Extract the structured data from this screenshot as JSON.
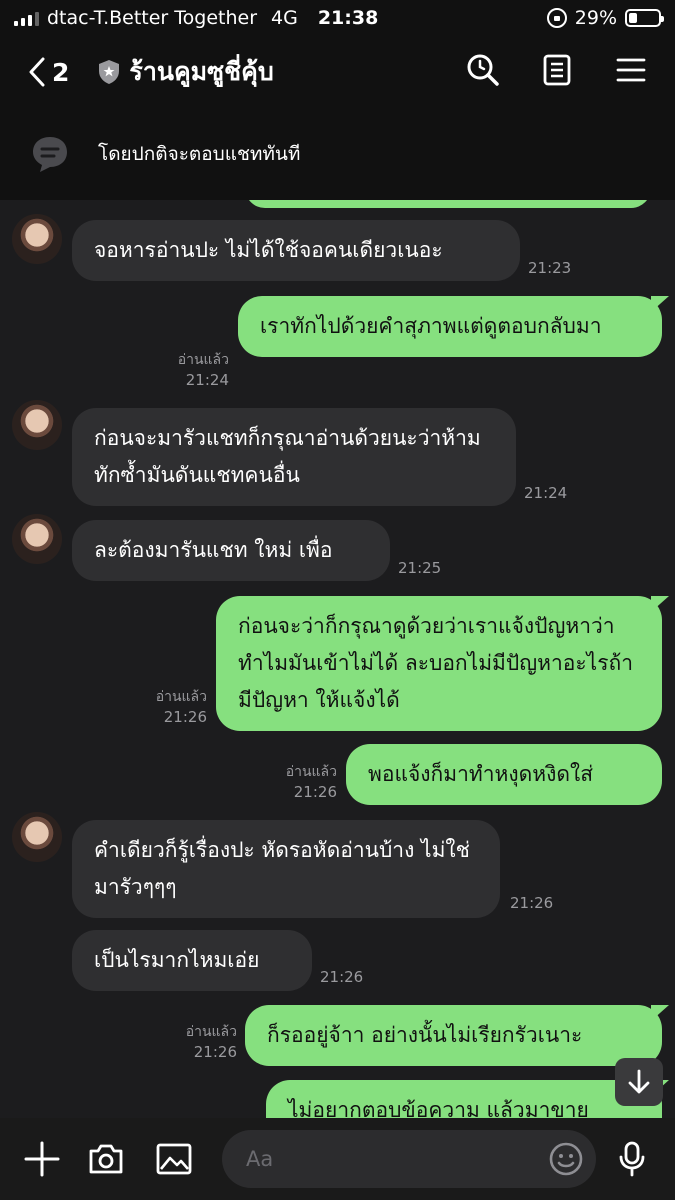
{
  "status": {
    "carrier": "dtac-T.Better Together",
    "network": "4G",
    "time": "21:38",
    "battery": "29%",
    "battery_level": 0.29
  },
  "header": {
    "back_count": "2",
    "title": "ร้านคูมซูชี่คุ้บ",
    "icons": [
      "back-icon",
      "shield-icon",
      "search-icon",
      "notes-icon",
      "menu-icon"
    ]
  },
  "notice": {
    "text": "โดยปกติจะตอบแชททันที",
    "icon": "chat-bubble-icon"
  },
  "messages": [
    {
      "side": "in",
      "text": "จอหารอ่านปะ ไม่ได้ใช้จอคนเดียวเนอะ",
      "time": "21:23"
    },
    {
      "side": "out",
      "text": "เราทักไปด้วยคำสุภาพแต่ดูตอบกลับมา",
      "status": "อ่านแล้ว",
      "time": "21:24"
    },
    {
      "side": "in",
      "text": "ก่อนจะมารัวแชทก็กรุณาอ่านด้วยนะว่าห้ามทักซ้ำมันดันแชทคนอื่น",
      "time": "21:24"
    },
    {
      "side": "in",
      "text": "ละต้องมารันแชท ใหม่ เพื่อ",
      "time": "21:25"
    },
    {
      "side": "out",
      "text": "ก่อนจะว่าก็กรุณาดูด้วยว่าเราแจ้งปัญหาว่าทำไมมันเข้าไม่ได้ ละบอกไม่มีปัญหาอะไรถ้ามีปัญหา ให้แจ้งได้",
      "status": "อ่านแล้ว",
      "time": "21:26"
    },
    {
      "side": "out",
      "text": "พอแจ้งก็มาทำหงุดหงิดใส่",
      "status": "อ่านแล้ว",
      "time": "21:26"
    },
    {
      "side": "in",
      "text": "คำเดียวก็รู้เรื่องปะ หัดรอหัดอ่านบ้าง ไม่ใช่มารัวๆๆๆ",
      "time": "21:26"
    },
    {
      "side": "in",
      "text": "เป็นไรมากไหมเอ่ย",
      "time": "21:26"
    },
    {
      "side": "out",
      "text": "ก็รออยู่จ้าา อย่างนั้นไม่เรียกรัวเนาะ",
      "status": "อ่านแล้ว",
      "time": "21:26"
    },
    {
      "side": "out",
      "text": "ไม่อยากตอบข้อความ แล้วมาขาย",
      "status": "",
      "time": ""
    }
  ],
  "input": {
    "placeholder": "Aa",
    "icons": [
      "plus-icon",
      "camera-icon",
      "image-icon",
      "emoji-icon",
      "mic-icon"
    ]
  },
  "colors": {
    "outgoing_bubble": "#86e07f",
    "incoming_bubble": "#2f2f31",
    "background": "#1c1c1e"
  }
}
